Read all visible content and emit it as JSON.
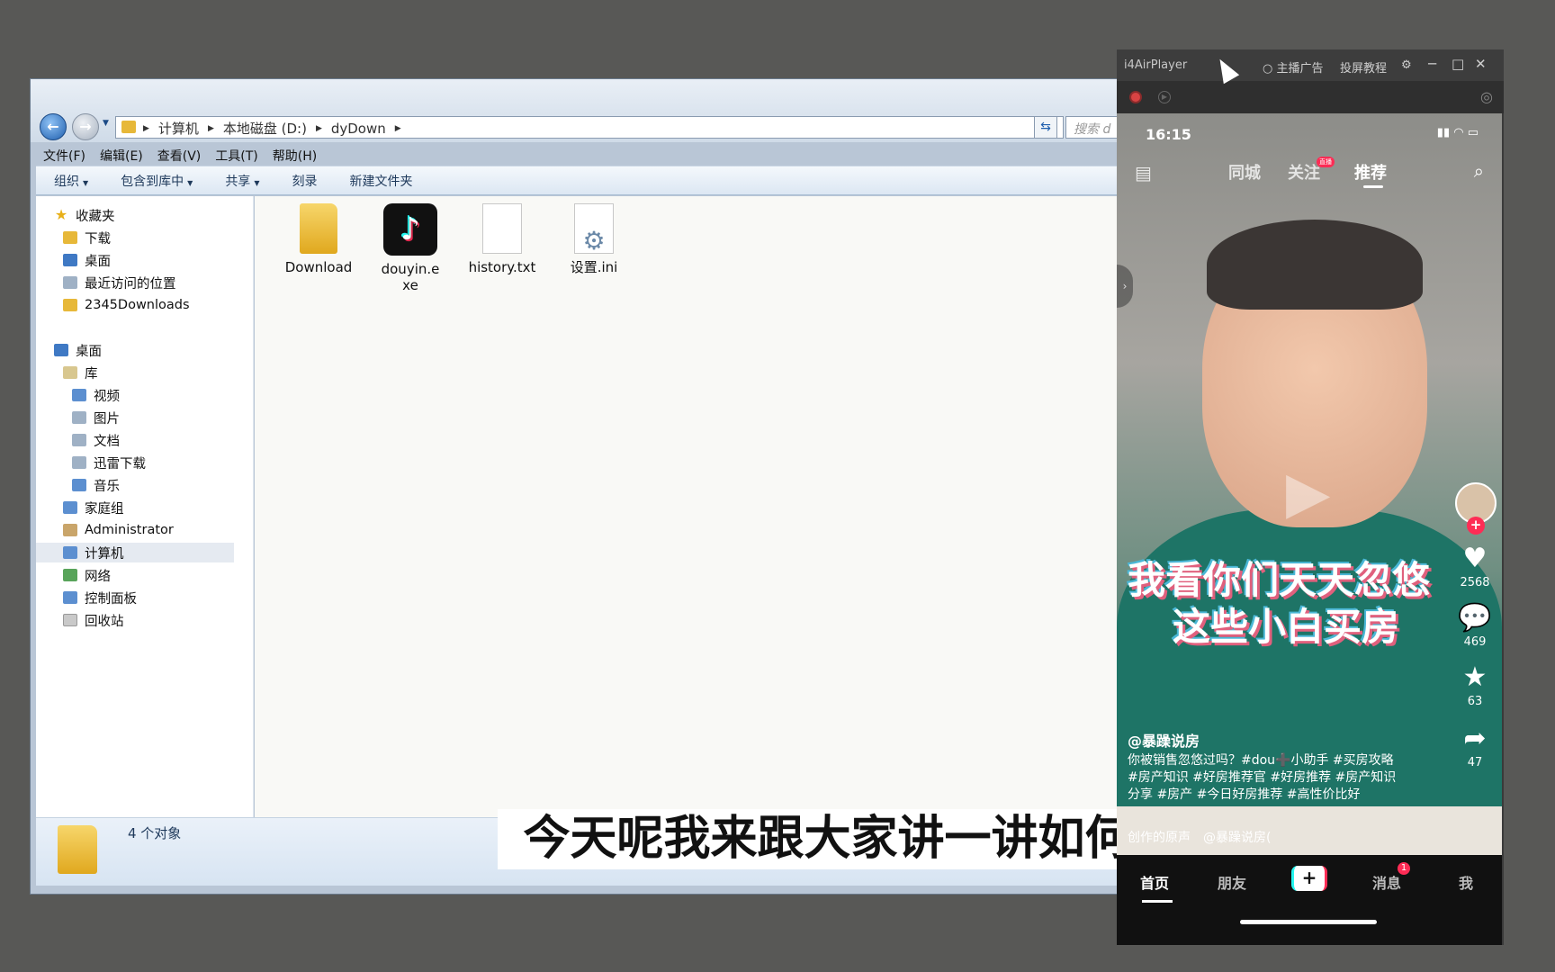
{
  "explorer": {
    "address": [
      "计算机",
      "本地磁盘 (D:)",
      "dyDown"
    ],
    "search_placeholder": "搜索 d",
    "menu": [
      "文件(F)",
      "编辑(E)",
      "查看(V)",
      "工具(T)",
      "帮助(H)"
    ],
    "toolbar": [
      "组织",
      "包含到库中",
      "共享",
      "刻录",
      "新建文件夹"
    ],
    "nav": {
      "favorites": "收藏夹",
      "fav_items": [
        "下载",
        "桌面",
        "最近访问的位置",
        "2345Downloads"
      ],
      "desktop": "桌面",
      "library": "库",
      "lib_items": [
        "视频",
        "图片",
        "文档",
        "迅雷下载",
        "音乐"
      ],
      "others": [
        "家庭组",
        "Administrator",
        "计算机",
        "网络",
        "控制面板",
        "回收站"
      ]
    },
    "files": [
      {
        "name": "Download",
        "icon": "folder-icon"
      },
      {
        "name": "douyin.exe",
        "icon": "tiktok-app-icon"
      },
      {
        "name": "history.txt",
        "icon": "text-file-icon"
      },
      {
        "name": "设置.ini",
        "icon": "settings-file-icon"
      }
    ],
    "status": "4 个对象"
  },
  "subtitle": "今天呢我来跟大家讲一讲如何",
  "player": {
    "title": "i4AirPlayer",
    "option1": "主播广告",
    "option2": "投屏教程",
    "phone": {
      "time": "16:15",
      "top_tabs": [
        "同城",
        "关注",
        "推荐"
      ],
      "live_badge": "直播",
      "caption_line1": "我看你们天天忽悠",
      "caption_line2": "这些小白买房",
      "likes": "2568",
      "comments": "469",
      "favorites": "63",
      "shares": "47",
      "author": "@暴躁说房",
      "description": "你被销售忽悠过吗？#dou➕小助手 #买房攻略 #房产知识 #好房推荐官 #好房推荐 #房产知识分享 #房产 #今日好房推荐 #高性价比好",
      "music": "创作的原声　@暴躁说房(",
      "bottom_nav": [
        "首页",
        "朋友",
        "+",
        "消息",
        "我"
      ],
      "message_badge": "1"
    }
  }
}
